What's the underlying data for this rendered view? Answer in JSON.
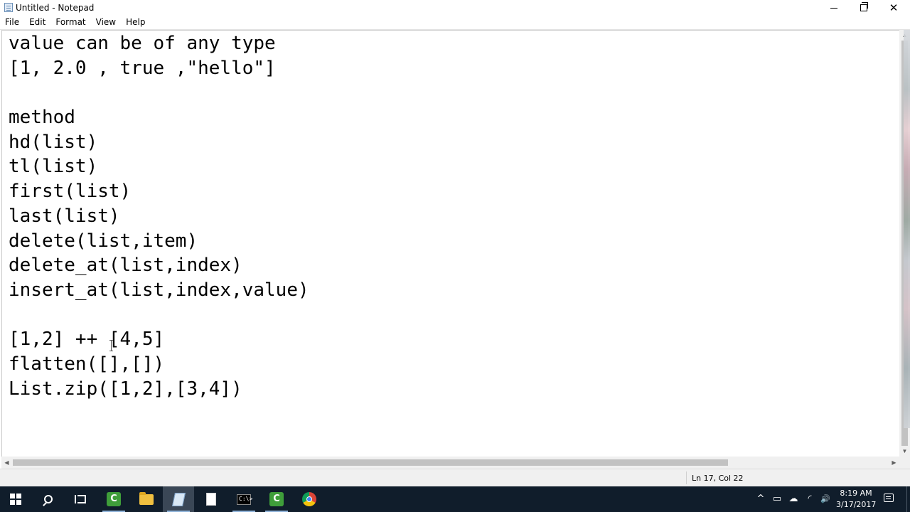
{
  "window": {
    "title": "Untitled - Notepad",
    "close_glyph": "✕"
  },
  "menu": [
    "File",
    "Edit",
    "Format",
    "View",
    "Help"
  ],
  "editor": {
    "lines": [
      "value can be of any type",
      "[1, 2.0 , true ,\"hello\"]",
      "",
      "method",
      "hd(list)",
      "tl(list)",
      "first(list)",
      "last(list)",
      "delete(list,item)",
      "delete_at(list,index)",
      "insert_at(list,index,value)",
      "",
      "[1,2] ++ [4,5]",
      "flatten([],[])",
      "List.zip([1,2],[3,4])"
    ]
  },
  "status": {
    "position": "Ln 17, Col 22"
  },
  "taskbar": {
    "apps": [
      "start-icon",
      "search-icon",
      "task-view-icon",
      "camtasia-icon",
      "file-explorer-icon",
      "notepad-icon",
      "blank-file-icon",
      "command-prompt-icon",
      "camtasia-recorder-icon",
      "chrome-icon"
    ],
    "camtasia_letter": "C",
    "cmd_prompt": "C:\\>",
    "tray": {
      "chevron": "^",
      "wifi": "◜",
      "volume": "🔊"
    },
    "clock": {
      "time": "8:19 AM",
      "date": "3/17/2017"
    }
  }
}
